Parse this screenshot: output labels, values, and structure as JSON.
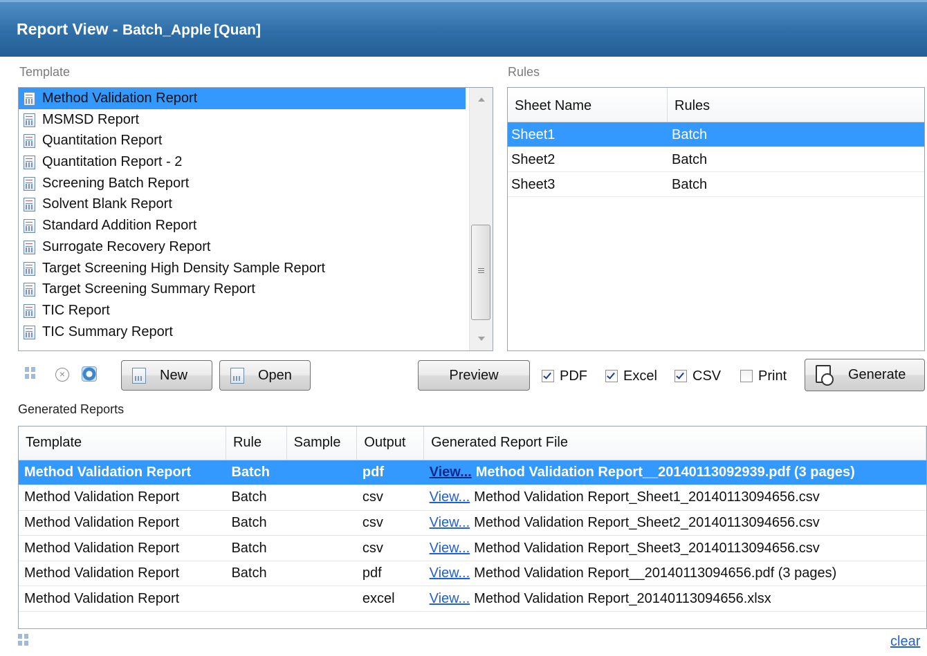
{
  "window": {
    "title_prefix": "Report View - ",
    "batch_name": "Batch_Apple",
    "batch_kind": "[Quan]"
  },
  "template_section": {
    "label": "Template",
    "items": [
      "Method Validation Report",
      "MSMSD Report",
      "Quantitation Report",
      "Quantitation Report - 2",
      "Screening Batch Report",
      "Solvent Blank Report",
      "Standard Addition Report",
      "Surrogate Recovery Report",
      "Target Screening High Density Sample Report",
      "Target Screening Summary Report",
      "TIC Report",
      "TIC Summary Report"
    ],
    "selected_index": 0
  },
  "rules_section": {
    "label": "Rules",
    "columns": [
      "Sheet Name",
      "Rules"
    ],
    "rows": [
      [
        "Sheet1",
        "Batch"
      ],
      [
        "Sheet2",
        "Batch"
      ],
      [
        "Sheet3",
        "Batch"
      ]
    ],
    "selected_index": 0
  },
  "toolbar": {
    "new_label": "New",
    "open_label": "Open",
    "preview_label": "Preview",
    "generate_label": "Generate",
    "options": [
      {
        "label": "PDF",
        "checked": true
      },
      {
        "label": "Excel",
        "checked": true
      },
      {
        "label": "CSV",
        "checked": true
      },
      {
        "label": "Print",
        "checked": false
      }
    ]
  },
  "generated_reports": {
    "label": "Generated Reports",
    "columns": [
      "Template",
      "Rule",
      "Sample",
      "Output",
      "Generated Report File"
    ],
    "view_label": "View...",
    "rows": [
      [
        "Method Validation Report",
        "Batch",
        "",
        "pdf",
        "Method Validation Report__20140113092939.pdf (3 pages)"
      ],
      [
        "Method Validation Report",
        "Batch",
        "",
        "csv",
        "Method Validation Report_Sheet1_20140113094656.csv"
      ],
      [
        "Method Validation Report",
        "Batch",
        "",
        "csv",
        "Method Validation Report_Sheet2_20140113094656.csv"
      ],
      [
        "Method Validation Report",
        "Batch",
        "",
        "csv",
        "Method Validation Report_Sheet3_20140113094656.csv"
      ],
      [
        "Method Validation Report",
        "Batch",
        "",
        "pdf",
        "Method Validation Report__20140113094656.pdf (3 pages)"
      ],
      [
        "Method Validation Report",
        "",
        "",
        "excel",
        "Method Validation Report_20140113094656.xlsx"
      ]
    ],
    "selected_index": 0,
    "clear_label": "clear"
  },
  "icons": {
    "template_item": "report-document-icon",
    "grid": "grid-icon",
    "remove": "close-circle-icon",
    "refresh": "refresh-icon",
    "generate": "generate-report-icon"
  },
  "colors": {
    "selection": "#3399ff",
    "title_bar": "#2f6ea7",
    "link": "#1f5fd8"
  }
}
